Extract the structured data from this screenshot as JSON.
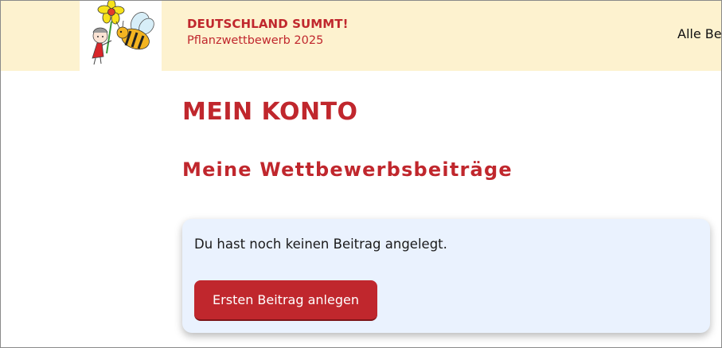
{
  "header": {
    "brand_title": "DEUTSCHLAND SUMMT!",
    "brand_subtitle": "Pflanzwettbewerb 2025",
    "nav_link": "Alle Be",
    "logo_icon": "bee-flower-logo-icon",
    "background_color": "#fdf2cf"
  },
  "main": {
    "page_title": "MEIN KONTO",
    "section_title": "Meine Wettbewerbsbeiträge",
    "card": {
      "message": "Du hast noch keinen Beitrag angelegt.",
      "button_label": "Ersten Beitrag anlegen",
      "background_color": "#eaf2fe"
    }
  },
  "colors": {
    "accent": "#c0272d"
  }
}
